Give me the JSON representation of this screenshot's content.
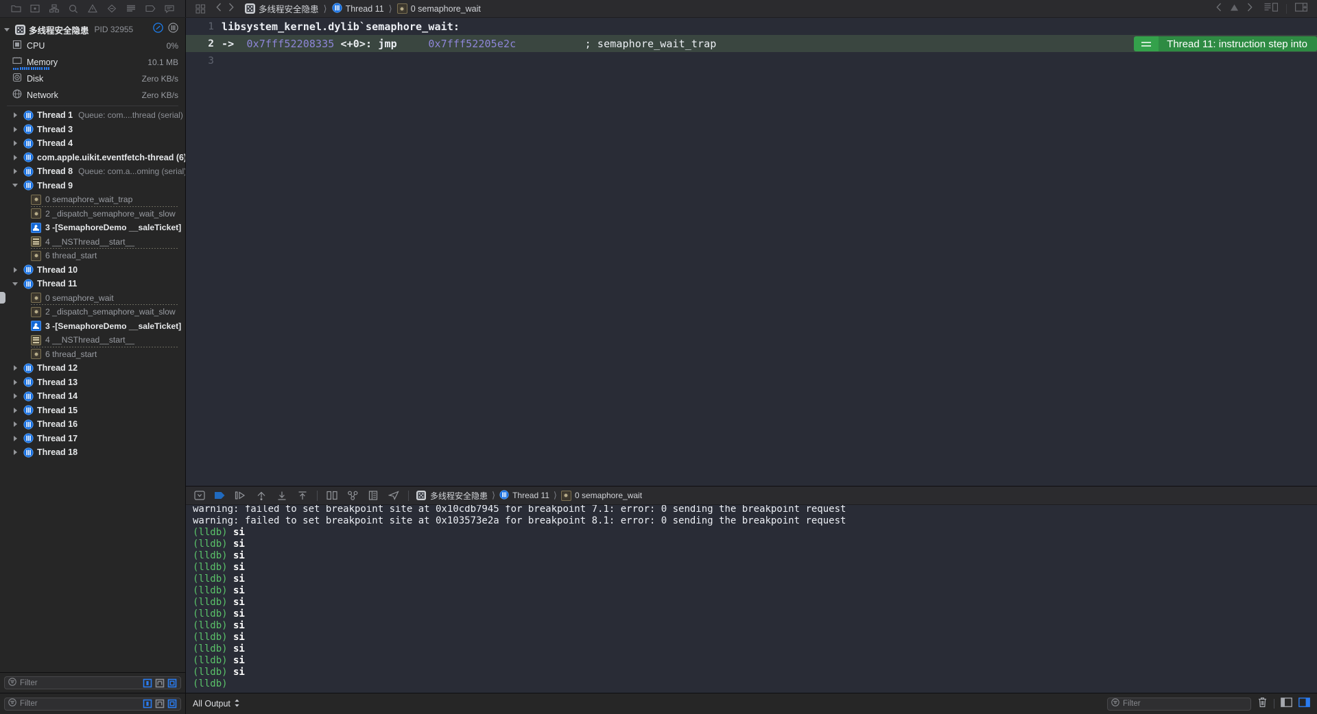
{
  "toolbar": {
    "left_icons": [
      "folder-icon",
      "version-editor-icon",
      "hierarchy-icon",
      "search-icon",
      "warning-icon",
      "breakpoint-icon",
      "report-icon",
      "tag-icon",
      "comment-icon"
    ],
    "nav_back": "chevron-left-icon",
    "nav_forward": "chevron-right-icon",
    "crumbs": [
      {
        "icon": "app-icon",
        "label": "多线程安全隐患"
      },
      {
        "icon": "thread-icon",
        "label": "Thread 11"
      },
      {
        "icon": "gear-icon",
        "label": "0 semaphore_wait"
      }
    ],
    "right_icons": [
      "inspector-icon",
      "assistant-editor-icon",
      "panels-icon"
    ]
  },
  "navigator": {
    "process": {
      "name": "多线程安全隐患",
      "pid_label": "PID 32955",
      "action_icons": [
        "pause-icon",
        "thread-icon"
      ]
    },
    "gauges": [
      {
        "name": "CPU",
        "value": "0%",
        "icon": "cpu-icon",
        "bar": false
      },
      {
        "name": "Memory",
        "value": "10.1 MB",
        "icon": "memory-icon",
        "bar": true
      },
      {
        "name": "Disk",
        "value": "Zero KB/s",
        "icon": "disk-icon",
        "bar": false
      },
      {
        "name": "Network",
        "value": "Zero KB/s",
        "icon": "network-icon",
        "bar": false
      }
    ],
    "threads": [
      {
        "label": "Thread 1",
        "queue": "Queue: com....thread (serial)",
        "expanded": false,
        "frames": []
      },
      {
        "label": "Thread 3",
        "queue": "",
        "expanded": false,
        "frames": []
      },
      {
        "label": "Thread 4",
        "queue": "",
        "expanded": false,
        "frames": []
      },
      {
        "label": "com.apple.uikit.eventfetch-thread (6)",
        "queue": "",
        "expanded": false,
        "frames": []
      },
      {
        "label": "Thread 8",
        "queue": "Queue: com.a...oming (serial)",
        "expanded": false,
        "frames": []
      },
      {
        "label": "Thread 9",
        "queue": "",
        "expanded": true,
        "frames": [
          {
            "label": "0 semaphore_wait_trap",
            "kind": "sys",
            "dashed": true,
            "current": false
          },
          {
            "label": "2 _dispatch_semaphore_wait_slow",
            "kind": "sys",
            "dashed": false,
            "current": false
          },
          {
            "label": "3 -[SemaphoreDemo __saleTicket]",
            "kind": "user",
            "dashed": false,
            "current": false
          },
          {
            "label": "4 __NSThread__start__",
            "kind": "list",
            "dashed": true,
            "current": false
          },
          {
            "label": "6 thread_start",
            "kind": "sys",
            "dashed": false,
            "current": false
          }
        ]
      },
      {
        "label": "Thread 10",
        "queue": "",
        "expanded": false,
        "frames": []
      },
      {
        "label": "Thread 11",
        "queue": "",
        "expanded": true,
        "frames": [
          {
            "label": "0 semaphore_wait",
            "kind": "sys",
            "dashed": true,
            "current": true
          },
          {
            "label": "2 _dispatch_semaphore_wait_slow",
            "kind": "sys",
            "dashed": false,
            "current": false
          },
          {
            "label": "3 -[SemaphoreDemo __saleTicket]",
            "kind": "user",
            "dashed": false,
            "current": false
          },
          {
            "label": "4 __NSThread__start__",
            "kind": "list",
            "dashed": true,
            "current": false
          },
          {
            "label": "6 thread_start",
            "kind": "sys",
            "dashed": false,
            "current": false
          }
        ]
      },
      {
        "label": "Thread 12",
        "queue": "",
        "expanded": false,
        "frames": []
      },
      {
        "label": "Thread 13",
        "queue": "",
        "expanded": false,
        "frames": []
      },
      {
        "label": "Thread 14",
        "queue": "",
        "expanded": false,
        "frames": []
      },
      {
        "label": "Thread 15",
        "queue": "",
        "expanded": false,
        "frames": []
      },
      {
        "label": "Thread 16",
        "queue": "",
        "expanded": false,
        "frames": []
      },
      {
        "label": "Thread 17",
        "queue": "",
        "expanded": false,
        "frames": []
      },
      {
        "label": "Thread 18",
        "queue": "",
        "expanded": false,
        "frames": []
      }
    ],
    "filter": {
      "placeholder": "Filter",
      "value": ""
    }
  },
  "editor": {
    "lines": [
      {
        "num": "1",
        "text": "libsystem_kernel.dylib`semaphore_wait:",
        "highlight": false
      },
      {
        "num": "2",
        "text": "-> 0x7fff52208335 <+0>: jmp    0x7fff52205e2c          ; semaphore_wait_trap",
        "highlight": true
      },
      {
        "num": "3",
        "text": "",
        "highlight": false
      }
    ],
    "line2": {
      "arrow": "->",
      "address": "0x7fff52208335",
      "offset": "<+0>:",
      "mnemonic": "jmp",
      "target": "0x7fff52205e2c",
      "comment": "; semaphore_wait_trap"
    },
    "step_badge": {
      "icon": "equals-icon",
      "text": "Thread 11: instruction step into",
      "color": "#2e8b43"
    }
  },
  "debug_bar": {
    "icons": [
      "hide-debug-icon",
      "continue-icon",
      "step-over-icon",
      "step-into-icon",
      "step-out-icon",
      "step-out-top-icon",
      "simulate-location-icon",
      "view-hierarchy-icon",
      "memory-graph-icon",
      "location-icon"
    ],
    "crumbs": [
      {
        "icon": "app-icon",
        "label": "多线程安全隐患"
      },
      {
        "icon": "thread-icon",
        "label": "Thread 11"
      },
      {
        "icon": "gear-icon",
        "label": "0 semaphore_wait"
      }
    ]
  },
  "console": {
    "lines": [
      {
        "type": "warn",
        "text": "warning: failed to set breakpoint site at 0x10cdb7945 for breakpoint 7.1: error: 0 sending the breakpoint request"
      },
      {
        "type": "warn",
        "text": "warning: failed to set breakpoint site at 0x103573e2a for breakpoint 8.1: error: 0 sending the breakpoint request"
      },
      {
        "type": "cmd",
        "prompt": "(lldb)",
        "text": " si"
      },
      {
        "type": "cmd",
        "prompt": "(lldb)",
        "text": " si"
      },
      {
        "type": "cmd",
        "prompt": "(lldb)",
        "text": " si"
      },
      {
        "type": "cmd",
        "prompt": "(lldb)",
        "text": " si"
      },
      {
        "type": "cmd",
        "prompt": "(lldb)",
        "text": " si"
      },
      {
        "type": "cmd",
        "prompt": "(lldb)",
        "text": " si"
      },
      {
        "type": "cmd",
        "prompt": "(lldb)",
        "text": " si"
      },
      {
        "type": "cmd",
        "prompt": "(lldb)",
        "text": " si"
      },
      {
        "type": "cmd",
        "prompt": "(lldb)",
        "text": " si"
      },
      {
        "type": "cmd",
        "prompt": "(lldb)",
        "text": " si"
      },
      {
        "type": "cmd",
        "prompt": "(lldb)",
        "text": " si"
      },
      {
        "type": "cmd",
        "prompt": "(lldb)",
        "text": " si"
      },
      {
        "type": "cmd",
        "prompt": "(lldb)",
        "text": " si"
      },
      {
        "type": "cmd",
        "prompt": "(lldb)",
        "text": ""
      }
    ]
  },
  "statusbar": {
    "nav_filter": {
      "placeholder": "Filter",
      "value": ""
    },
    "output_scope": "All Output",
    "console_filter": {
      "placeholder": "Filter",
      "value": ""
    },
    "right_icons": [
      "trash-icon",
      "variables-pane-icon",
      "console-pane-icon"
    ]
  }
}
